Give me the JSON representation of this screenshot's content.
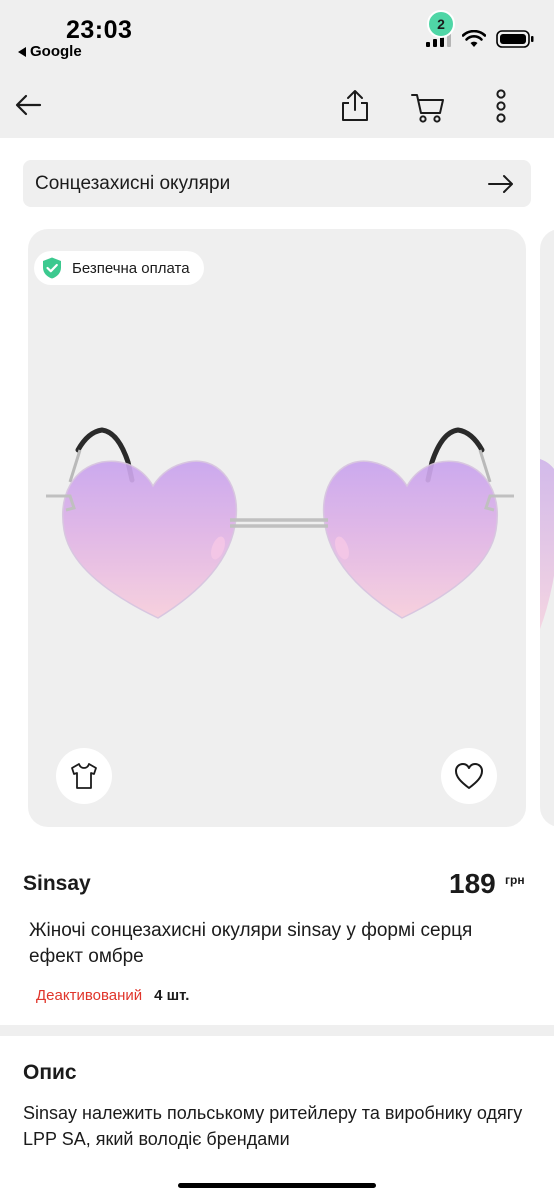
{
  "status_bar": {
    "time": "23:03",
    "back_app": "Google"
  },
  "nav": {
    "cart_count": "2"
  },
  "search": {
    "query": "Сонцезахисні окуляри"
  },
  "gallery": {
    "badge_label": "Безпечна оплата"
  },
  "product": {
    "brand": "Sinsay",
    "price": "189",
    "currency": "грн",
    "title": "Жіночі сонцезахисні окуляри sinsay у формі серця ефект омбре",
    "status": "Деактивований",
    "quantity": "4 шт."
  },
  "description": {
    "heading": "Опис",
    "text": "Sinsay належить польському ритейлеру та виробнику одягу LPP SA, який володіє брендами"
  },
  "colors": {
    "accent_badge": "#4fd6a6",
    "status_red": "#e0352b",
    "safe_pay_icon": "#3cc98f",
    "background_gray": "#efefef"
  },
  "icons": {
    "back": "arrow-left-icon",
    "share": "share-icon",
    "cart": "cart-icon",
    "more": "more-vertical-icon",
    "search_go": "arrow-right-icon",
    "shield": "shield-check-icon",
    "try_on": "tshirt-icon",
    "favorite": "heart-icon"
  }
}
